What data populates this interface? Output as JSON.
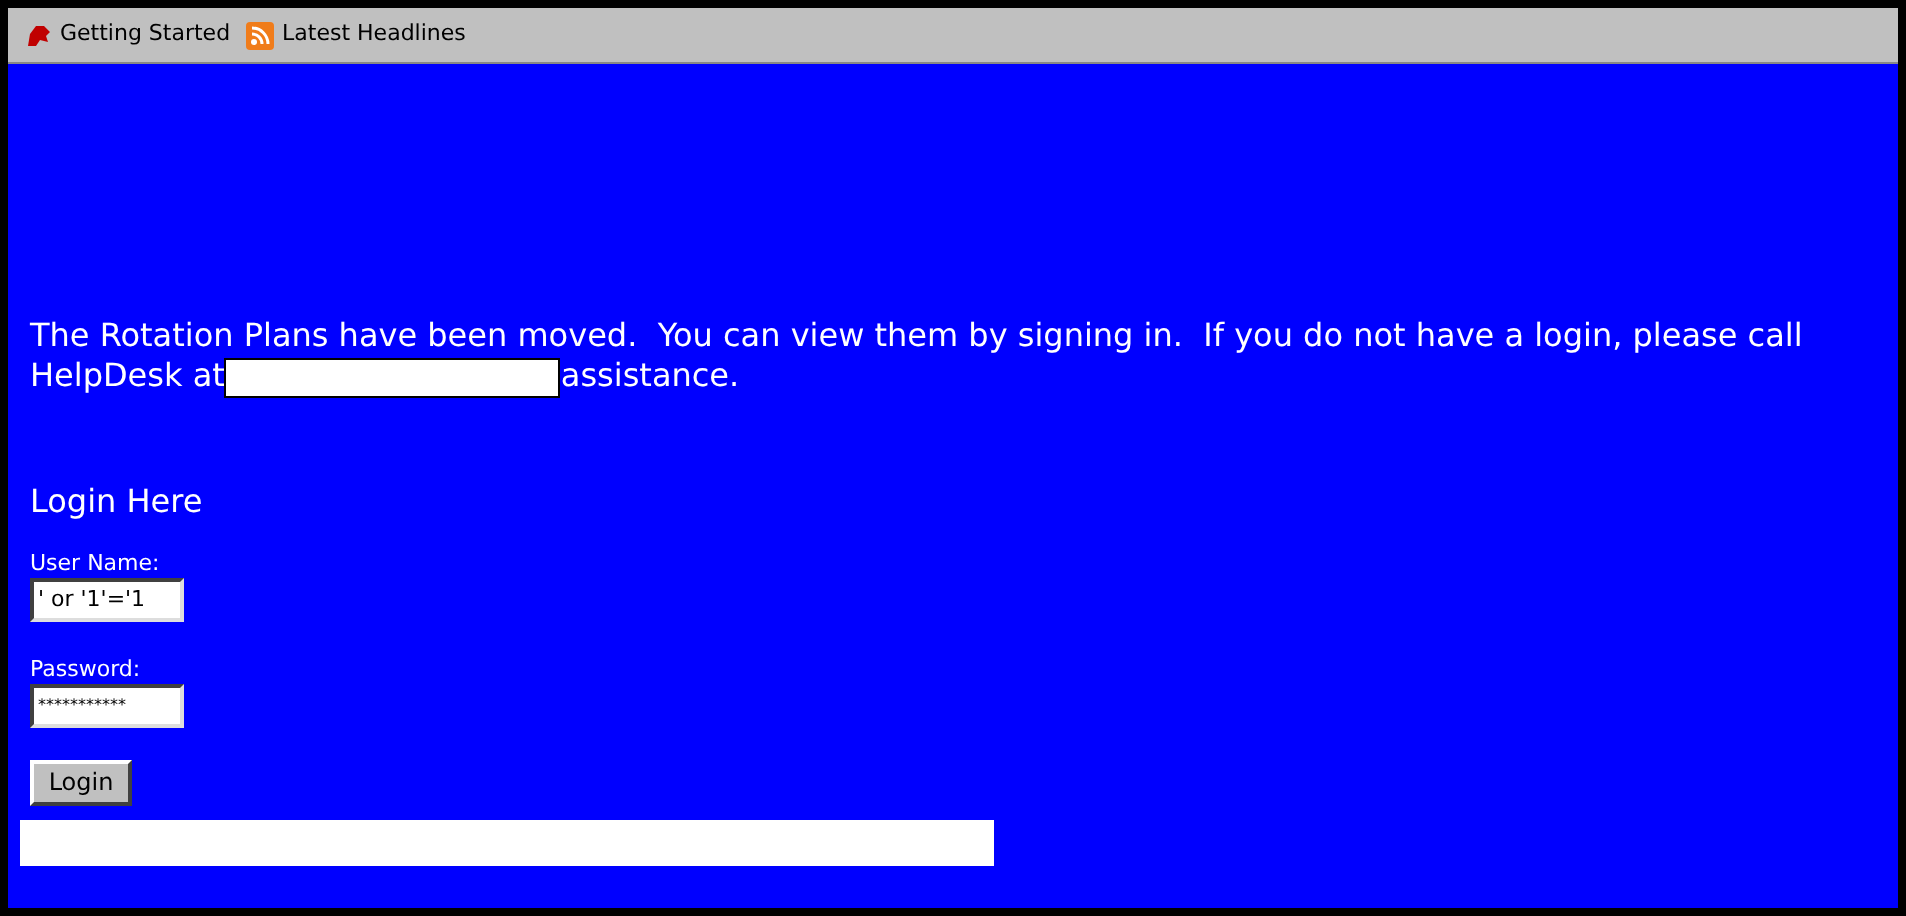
{
  "bookmarks_bar": {
    "items": [
      {
        "label": "Getting Started"
      },
      {
        "label": "Latest Headlines"
      }
    ]
  },
  "notice": {
    "before": "The Rotation Plans have been moved.  You can view them by signing in.  If you do not have a login, please call HelpDesk at",
    "after": "assistance."
  },
  "login": {
    "heading": "Login Here",
    "username_label": "User Name:",
    "username_value": "' or '1'='1",
    "password_label": "Password:",
    "password_value": "***********",
    "button": "Login"
  }
}
